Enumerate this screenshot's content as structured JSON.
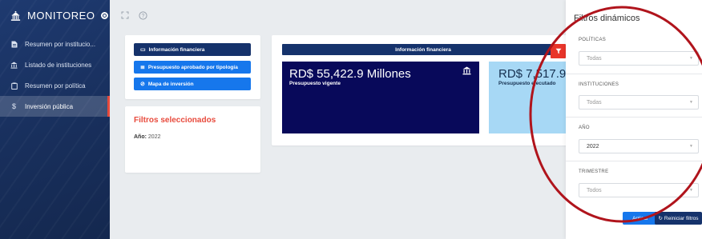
{
  "sidebar": {
    "brand": "MONITOREO",
    "items": [
      {
        "label": "Resumen por institucio...",
        "icon": "document-icon",
        "active": false
      },
      {
        "label": "Listado de instituciones",
        "icon": "bank-icon",
        "active": false
      },
      {
        "label": "Resumen por política",
        "icon": "clipboard-icon",
        "active": false
      },
      {
        "label": "Inversión pública",
        "icon": "dollar-icon",
        "active": true
      }
    ]
  },
  "topbar": {
    "icons": [
      "fullscreen-icon",
      "help-icon"
    ]
  },
  "actions": {
    "info_financiera": "Información financiera",
    "presupuesto_tipologia": "Presupuesto aprobado por tipología",
    "mapa_inversion": "Mapa de inversión"
  },
  "selected_filters": {
    "title": "Filtros seleccionados",
    "year_label": "Año:",
    "year_value": "2022"
  },
  "financial": {
    "header": "Información financiera",
    "vigente_amount": "RD$ 55,422.9 Millones",
    "vigente_label": "Presupuesto vigente",
    "ejecutado_amount": "RD$ 7,517.9",
    "ejecutado_label": "Presupuesto ejecutado"
  },
  "filter_panel": {
    "title": "Filtros dinámicos",
    "politicas_label": "POLÍTICAS",
    "politicas_value": "Todas",
    "instituciones_label": "INSTITUCIONES",
    "instituciones_value": "Todas",
    "anio_label": "AÑO",
    "anio_value": "2022",
    "trimestre_label": "TRIMESTRE",
    "trimestre_value": "Todos",
    "apply_label": "Aplicar",
    "reset_label": "Reiniciar filtros"
  },
  "colors": {
    "sidebar": "#1b3566",
    "navy": "#15326b",
    "bright_blue": "#1677ec",
    "accent_red": "#e84a3c",
    "kpi_dark": "#08095a",
    "kpi_light": "#a7d8f5",
    "annotation": "#b0141c"
  }
}
